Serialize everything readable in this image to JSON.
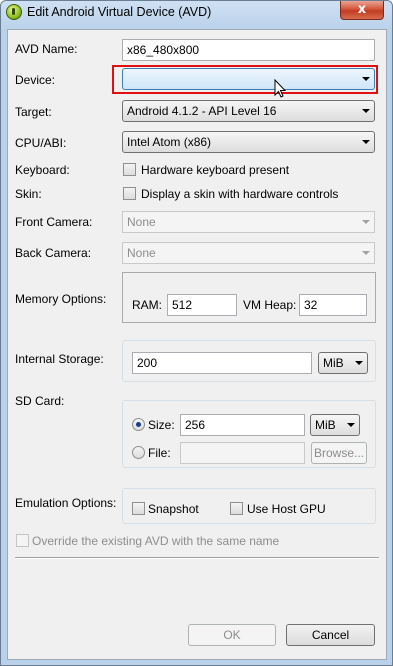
{
  "window": {
    "title": "Edit Android Virtual Device (AVD)",
    "close_glyph": "x",
    "app_icon": "android-sdk-icon"
  },
  "form": {
    "avd_name_label": "AVD Name:",
    "avd_name_value": "x86_480x800",
    "device_label": "Device:",
    "device_value": "",
    "target_label": "Target:",
    "target_value": "Android 4.1.2 - API Level 16",
    "cpu_label": "CPU/ABI:",
    "cpu_value": "Intel Atom (x86)",
    "keyboard_label": "Keyboard:",
    "keyboard_option": "Hardware keyboard present",
    "skin_label": "Skin:",
    "skin_option": "Display a skin with hardware controls",
    "front_camera_label": "Front Camera:",
    "front_camera_value": "None",
    "back_camera_label": "Back Camera:",
    "back_camera_value": "None",
    "memory_label": "Memory Options:",
    "ram_label": "RAM:",
    "ram_value": "512",
    "vm_heap_label": "VM Heap:",
    "vm_heap_value": "32",
    "internal_storage_label": "Internal Storage:",
    "internal_storage_value": "200",
    "internal_storage_unit": "MiB",
    "sd_card_label": "SD Card:",
    "sd_size_label": "Size:",
    "sd_size_value": "256",
    "sd_size_unit": "MiB",
    "sd_file_label": "File:",
    "sd_file_value": "",
    "browse_label": "Browse...",
    "emulation_label": "Emulation Options:",
    "snapshot_label": "Snapshot",
    "host_gpu_label": "Use Host GPU",
    "override_label": "Override the existing AVD with the same name"
  },
  "buttons": {
    "ok": "OK",
    "cancel": "Cancel"
  },
  "annotation": {
    "highlight_color": "#e01010"
  }
}
